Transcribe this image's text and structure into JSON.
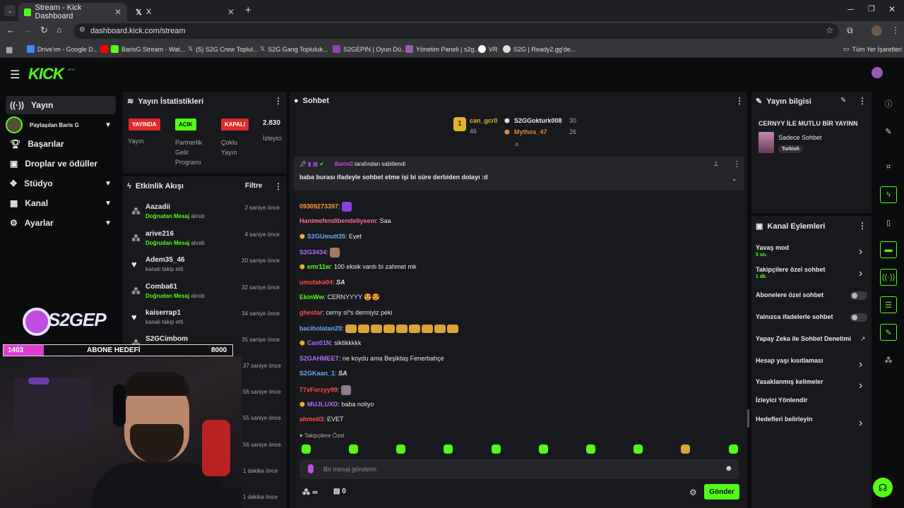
{
  "browser": {
    "tabs": [
      {
        "title": "Stream - Kick Dashboard",
        "active": true
      },
      {
        "title": "X",
        "active": false
      }
    ],
    "url": "dashboard.kick.com/stream",
    "bookmarks": [
      "Drive'ım - Google D...",
      "BarisG Stream - Wat...",
      "(5) S2G Crew Toplul...",
      "S2G Gang Topluluk...",
      "S2GEPIN | Oyun Dü...",
      "Yönetim Paneli | s2g...",
      "VR",
      "S2G | Ready2.gg'de..."
    ],
    "bookmarks_folder": "Tüm Yer İşaretleri"
  },
  "brand": {
    "logo": "KICK",
    "beta": "BETA",
    "accent": "#53fc18"
  },
  "sidebar": {
    "items": [
      {
        "label": "Yayın",
        "icon": "broadcast-icon",
        "active": true
      },
      {
        "label": "Paylaşılan Baris G",
        "icon": "avatar",
        "chevron": true
      },
      {
        "label": "Başarılar",
        "icon": "trophy-icon"
      },
      {
        "label": "Droplar ve ödüller",
        "icon": "gift-icon"
      },
      {
        "label": "Stüdyo",
        "icon": "studio-icon",
        "chevron": true
      },
      {
        "label": "Kanal",
        "icon": "channel-icon",
        "chevron": true
      },
      {
        "label": "Ayarlar",
        "icon": "gear-icon",
        "chevron": true
      }
    ]
  },
  "stats": {
    "title": "Yayın İstatistikleri",
    "live_badge": "YAYINDA",
    "live_label": "Yayın",
    "partner_badge": "ACIK",
    "partner_label": "Partnerlik Gelir Programı",
    "multi_badge": "KAPALI",
    "multi_label": "Çoklu Yayın",
    "viewers": "2.830",
    "viewers_label": "İzleyici"
  },
  "activity": {
    "title": "Etkinlik Akışı",
    "filter": "Filtre",
    "events": [
      {
        "name": "Aazadii",
        "highlight": "Doğrudan Mesaj",
        "rest": " alındı",
        "time": "2 saniye önce",
        "icon": "dm-icon"
      },
      {
        "name": "arive216",
        "highlight": "Doğrudan Mesaj",
        "rest": " alındı",
        "time": "4 saniye önce",
        "icon": "dm-icon"
      },
      {
        "name": "Adem35_46",
        "highlight": "",
        "rest": "kanalı takip etti",
        "time": "20 saniye önce",
        "icon": "heart-icon"
      },
      {
        "name": "Comba61",
        "highlight": "Doğrudan Mesaj",
        "rest": " alındı",
        "time": "32 saniye önce",
        "icon": "dm-icon"
      },
      {
        "name": "kaiserrap1",
        "highlight": "",
        "rest": "kanalı takip etti",
        "time": "34 saniye önce",
        "icon": "heart-icon"
      },
      {
        "name": "S2GCimbom",
        "highlight": "Doğrudan Mesaj",
        "rest": " alındı",
        "time": "35 saniye önce",
        "icon": "dm-icon"
      }
    ],
    "extra_times": [
      "37 saniye önce",
      "56 saniye önce",
      "55 saniye önce",
      "56 saniye önce",
      "1 dakika önce",
      "1 dakika önce"
    ]
  },
  "overlay": {
    "logo_text": "S2GEP",
    "goal_current": "1403",
    "goal_label": "ABONE HEDEFİ",
    "goal_target": "8000",
    "goal_progress": 0.175
  },
  "chat": {
    "title": "Sohbet",
    "top_gifters": [
      {
        "rank": "1",
        "name": "can_gcr0",
        "count": "46"
      },
      {
        "name": "S2GGokturk008",
        "count": "30"
      },
      {
        "name": "Mythos_47",
        "count": "26"
      }
    ],
    "pinned_by": "BarisG",
    "pinned_suffix": "tarafından sabitlendi",
    "pinned_text": "baba burası ifadeyle sohbet etme işi bi süre derbiden dolayı :d",
    "messages": [
      {
        "user": "09309273397",
        "text": "",
        "color": "#ff9a3c",
        "emote": "purple"
      },
      {
        "user": "Hanimefendibendeliyeem",
        "text": "Saa",
        "color": "#ff6b9a"
      },
      {
        "user": "S2GUmutt35",
        "text": "Evet",
        "color": "#6aa8ff",
        "badge": true
      },
      {
        "user": "S2G3434",
        "text": "",
        "color": "#b06bff",
        "emote": "face"
      },
      {
        "user": "emr11w",
        "text": "100 eksik vardı bi zahmet mk",
        "color": "#53fc18",
        "badge": true
      },
      {
        "user": "umutaka04",
        "text": "SA",
        "color": "#ff4d4d",
        "bold_text": true
      },
      {
        "user": "EkinWw",
        "text": "CERNYYYY 😍😍",
        "color": "#53fc18"
      },
      {
        "user": "ghestar",
        "text": "cerny si*s dermiyiz peki",
        "color": "#ff4d4d"
      },
      {
        "user": "baciholatan20",
        "text": "",
        "color": "#6aa8ff",
        "emote": "row"
      },
      {
        "user": "Can01N",
        "text": "siktikkkkk",
        "color": "#b06bff",
        "badge": true
      },
      {
        "user": "S2GAHMEET",
        "text": "ne koydu ama Beşiktaş Fenerbahçe",
        "color": "#b06bff"
      },
      {
        "user": "S2GKaan_1",
        "text": "SA",
        "color": "#6aa8ff",
        "bold_text": true
      },
      {
        "user": "77xForzyy99",
        "text": "",
        "color": "#ff4d4d",
        "emote": "gray"
      },
      {
        "user": "MUJLUXD",
        "text": "baba noliyo",
        "color": "#b06bff",
        "badge": true
      },
      {
        "user": "ahmeti3",
        "text": "EVET",
        "color": "#ff4d4d"
      }
    ],
    "followers_only_label": "Takipçilere Özel",
    "input_placeholder": "Bir mesaj gönderin",
    "points": "∞",
    "gifts": "0",
    "send": "Gönder"
  },
  "stream_info": {
    "title": "Yayın bilgisi",
    "stream_title": "CERNYY İLE MUTLU BİR YAYINN",
    "category": "Sadece Sohbet",
    "tag": "Turkish"
  },
  "channel_actions": {
    "title": "Kanal Eylemleri",
    "items": [
      {
        "label": "Yavaş mod",
        "sub": "5 sn.",
        "control": "chevron"
      },
      {
        "label": "Takipçilere özel sohbet",
        "sub": "1 dk.",
        "control": "chevron"
      },
      {
        "label": "Abonelere özel sohbet",
        "sub": "",
        "control": "toggle"
      },
      {
        "label": "Yalnızca ifadelerle sohbet",
        "sub": "",
        "control": "toggle"
      },
      {
        "label": "Yapay Zeka ile Sohbet Denetimi",
        "sub": "",
        "control": "external"
      },
      {
        "label": "Hesap yaşı kısıtlaması",
        "sub": "",
        "control": "chevron"
      },
      {
        "label": "Yasaklanmış kelimeler",
        "sub": "",
        "control": "chevron"
      },
      {
        "label": "İzleyici Yönlendir",
        "sub": "",
        "control": "none"
      },
      {
        "label": "Hedefleri belirleyin",
        "sub": "",
        "control": "chevron"
      }
    ]
  }
}
